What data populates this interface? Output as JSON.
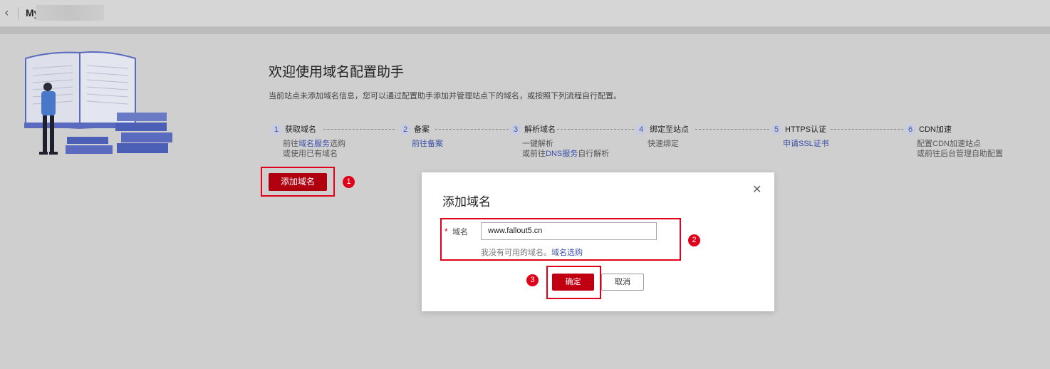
{
  "header": {
    "back_icon": "chevron-left-icon",
    "site_name": "My"
  },
  "main": {
    "welcome_title": "欢迎使用域名配置助手",
    "description": "当前站点未添加域名信息，您可以通过配置助手添加并管理站点下的域名，或按照下列流程自行配置。",
    "add_button": "添加域名",
    "steps": [
      {
        "num": "1",
        "name": "获取域名",
        "line1_pre": "前往",
        "line1_link": "域名服务",
        "line1_post": "选购",
        "line2": "或使用已有域名"
      },
      {
        "num": "2",
        "name": "备案",
        "line1_link": "前往备案"
      },
      {
        "num": "3",
        "name": "解析域名",
        "line1": "一键解析",
        "line2_pre": "或前往",
        "line2_link": "DNS服务",
        "line2_post": "自行解析"
      },
      {
        "num": "4",
        "name": "绑定至站点",
        "line1": "快速绑定"
      },
      {
        "num": "5",
        "name": "HTTPS认证",
        "line1_link": "申请SSL证书"
      },
      {
        "num": "6",
        "name": "CDN加速",
        "line1": "配置CDN加速站点",
        "line2": "或前往后台管理自助配置"
      }
    ]
  },
  "dialog": {
    "title": "添加域名",
    "close_icon": "close-icon",
    "required_mark": "*",
    "field_label": "域名",
    "field_value": "www.fallout5.cn",
    "hint_text": "我没有可用的域名。",
    "hint_link": "域名选购",
    "ok_label": "确定",
    "cancel_label": "取消"
  },
  "annotations": {
    "badge1": "1",
    "badge2": "2",
    "badge3": "3",
    "highlight_color": "#e0001a"
  },
  "colors": {
    "primary": "#c00012",
    "link": "#3a4fa8"
  }
}
